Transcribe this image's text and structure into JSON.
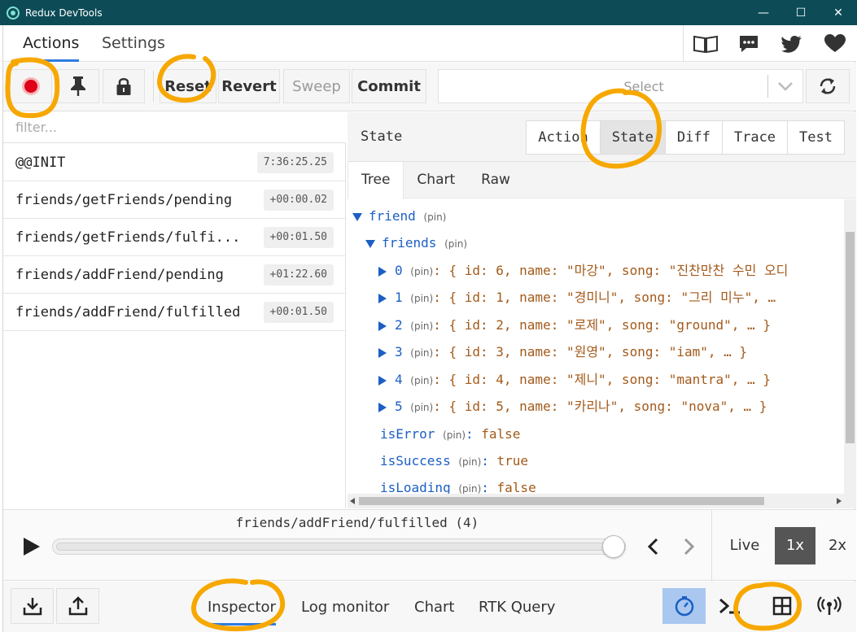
{
  "window": {
    "title": "Redux DevTools",
    "minimize": "—",
    "maximize": "☐",
    "close": "✕"
  },
  "top_tabs": [
    {
      "label": "Actions",
      "active": true
    },
    {
      "label": "Settings",
      "active": false
    }
  ],
  "top_icons": [
    "book-icon",
    "chat-icon",
    "twitter-icon",
    "heart-icon"
  ],
  "toolbar": {
    "record_icon": "record-icon",
    "pin_icon": "pin-icon",
    "lock_icon": "lock-icon",
    "reset_label": "Reset",
    "revert_label": "Revert",
    "sweep_label": "Sweep",
    "commit_label": "Commit",
    "select_placeholder": "Select",
    "sync_icon": "sync-icon"
  },
  "actions": {
    "filter_placeholder": "filter...",
    "items": [
      {
        "name": "@@INIT",
        "time": "7:36:25.25"
      },
      {
        "name": "friends/getFriends/pending",
        "time": "+00:00.02"
      },
      {
        "name": "friends/getFriends/fulfi...",
        "time": "+00:01.50"
      },
      {
        "name": "friends/addFriend/pending",
        "time": "+01:22.60"
      },
      {
        "name": "friends/addFriend/fulfilled",
        "time": "+00:01.50"
      }
    ]
  },
  "inspector": {
    "header_label": "State",
    "monitor_tabs": [
      {
        "label": "Action",
        "active": false
      },
      {
        "label": "State",
        "active": true
      },
      {
        "label": "Diff",
        "active": false
      },
      {
        "label": "Trace",
        "active": false
      },
      {
        "label": "Test",
        "active": false
      }
    ],
    "sub_tabs": [
      {
        "label": "Tree",
        "active": true
      },
      {
        "label": "Chart",
        "active": false
      },
      {
        "label": "Raw",
        "active": false
      }
    ],
    "pin_label": "(pin)",
    "tree": {
      "root_key": "friend",
      "friends_key": "friends",
      "items": [
        {
          "index": "0",
          "summary": ": { id: 6, name: \"마강\", song: \"진찬만찬 수민 오디"
        },
        {
          "index": "1",
          "summary": ": { id: 1, name: \"경미니\", song: \"그리 미누\", …"
        },
        {
          "index": "2",
          "summary": ": { id: 2, name: \"로제\", song: \"ground\", … }"
        },
        {
          "index": "3",
          "summary": ": { id: 3, name: \"원영\", song: \"iam\", … }"
        },
        {
          "index": "4",
          "summary": ": { id: 4, name: \"제니\", song: \"mantra\", … }"
        },
        {
          "index": "5",
          "summary": ": { id: 5, name: \"카리나\", song: \"nova\", … }"
        }
      ],
      "flags": [
        {
          "key": "isError",
          "value": "false"
        },
        {
          "key": "isSuccess",
          "value": "true"
        },
        {
          "key": "isLoading",
          "value": "false"
        }
      ]
    }
  },
  "slider": {
    "label": "friends/addFriend/fulfilled",
    "count": "(4)",
    "position": 1.0,
    "speeds": [
      {
        "label": "Live",
        "active": false
      },
      {
        "label": "1x",
        "active": true
      },
      {
        "label": "2x",
        "active": false
      }
    ]
  },
  "bottom_bar": {
    "tabs": [
      {
        "label": "Inspector",
        "active": true
      },
      {
        "label": "Log monitor",
        "active": false
      },
      {
        "label": "Chart",
        "active": false
      },
      {
        "label": "RTK Query",
        "active": false
      }
    ]
  },
  "colors": {
    "titlebar": "#0d4c57",
    "accent": "#2d7be1",
    "record": "#e0001a",
    "tree_key": "#1c5fc4",
    "tree_value": "#a35a1a",
    "annotation": "#f7a800"
  }
}
